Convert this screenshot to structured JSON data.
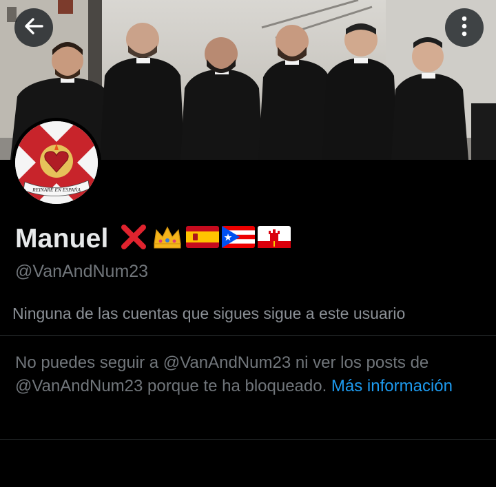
{
  "profile": {
    "display_name": "Manuel",
    "handle": "@VanAndNum23",
    "name_emojis": [
      "cross-mark-emoji",
      "crown-emoji",
      "spain-flag-emoji",
      "puerto-rico-flag-emoji",
      "gibraltar-flag-emoji"
    ],
    "avatar_text": "REINARÉ EN ESPAÑA"
  },
  "header": {
    "back_icon": "arrow-left-icon",
    "more_icon": "vertical-dots-icon"
  },
  "followers_note": "Ninguna de las cuentas que sigues sigue a este usuario",
  "blocked": {
    "message_part1": "No puedes seguir a @VanAndNum23 ni ver los posts de @VanAndNum23 porque te ha bloqueado.",
    "link_label": "Más información"
  },
  "colors": {
    "background": "#000000",
    "text_primary": "#e7e9ea",
    "text_secondary": "#71767b",
    "link": "#1d9bf0",
    "divider": "#2f3336"
  }
}
